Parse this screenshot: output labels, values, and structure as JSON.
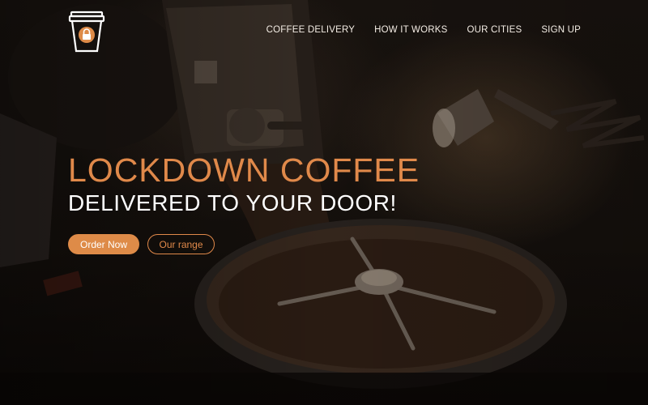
{
  "brand": {
    "logo_icon": "coffee-cup-lock-icon",
    "accent": "#de8b48"
  },
  "nav": {
    "items": [
      {
        "label": "COFFEE DELIVERY"
      },
      {
        "label": "HOW IT WORKS"
      },
      {
        "label": "OUR CITIES"
      },
      {
        "label": "SIGN UP"
      }
    ]
  },
  "hero": {
    "title": "LOCKDOWN COFFEE",
    "subtitle": "DELIVERED TO YOUR DOOR!",
    "primary_button": "Order Now",
    "secondary_button": "Our range"
  },
  "colors": {
    "title": "#e0894a",
    "subtitle": "#ffffff",
    "nav_text": "#f3ece4"
  }
}
